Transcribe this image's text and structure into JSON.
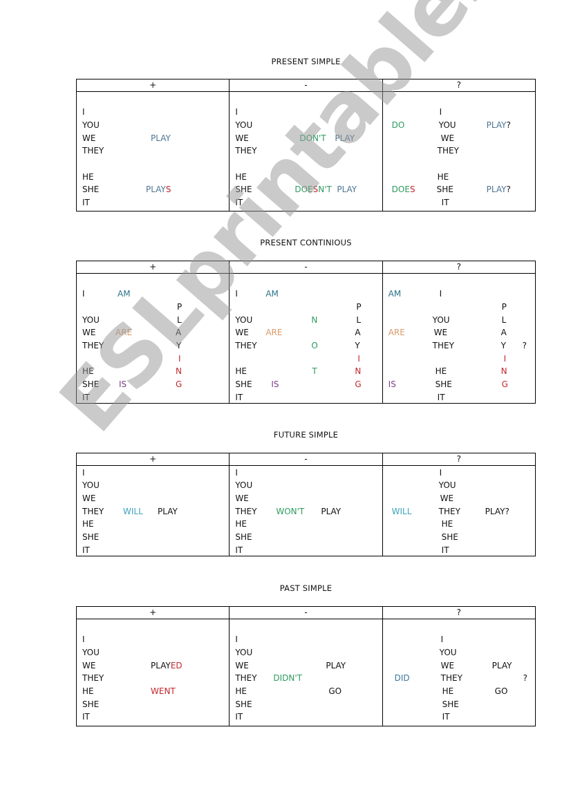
{
  "watermark": "ESLprintables.com",
  "headers": {
    "plus": "+",
    "minus": "-",
    "question": "?"
  },
  "sections": [
    {
      "title": "PRESENT SIMPLE",
      "plus": {
        "pronouns": [
          "I",
          "YOU",
          "WE",
          "THEY",
          "HE",
          "SHE",
          "IT"
        ],
        "verb_plural": "PLAY",
        "verb_singular_stem": "PLAY",
        "verb_singular_ending": "S"
      },
      "minus": {
        "pronouns": [
          "I",
          "YOU",
          "WE",
          "THEY",
          "HE",
          "SHE",
          "IT"
        ],
        "aux_plural": "DON'T",
        "verb_plural": "PLAY",
        "aux_singular_a": "DOE",
        "aux_singular_s": "S",
        "aux_singular_b": "N'T",
        "verb_singular": "PLAY"
      },
      "question": {
        "pronouns": [
          "I",
          "YOU",
          "WE",
          "THEY",
          "HE",
          "SHE",
          "IT"
        ],
        "aux_plural": "DO",
        "verb_plural": "PLAY",
        "qmark": "?",
        "aux_singular_stem": "DOE",
        "aux_singular_ending": "S",
        "verb_singular": "PLAY"
      }
    },
    {
      "title": "PRESENT CONTINIOUS",
      "plus": {
        "pronouns": [
          "I",
          "YOU",
          "WE",
          "THEY",
          "HE",
          "SHE",
          "IT"
        ],
        "aux_i": "AM",
        "aux_plural": "ARE",
        "aux_singular": "IS",
        "verb_letters": [
          "P",
          "L",
          "A",
          "Y",
          "I",
          "N",
          "G"
        ]
      },
      "minus": {
        "pronouns": [
          "I",
          "YOU",
          "WE",
          "THEY",
          "HE",
          "SHE",
          "IT"
        ],
        "aux_i": "AM",
        "aux_plural": "ARE",
        "aux_singular": "IS",
        "not_letters": [
          "N",
          "O",
          "T"
        ],
        "verb_letters": [
          "P",
          "L",
          "A",
          "Y",
          "I",
          "N",
          "G"
        ]
      },
      "question": {
        "pronouns": [
          "I",
          "YOU",
          "WE",
          "THEY",
          "HE",
          "SHE",
          "IT"
        ],
        "aux_i": "AM",
        "aux_plural": "ARE",
        "aux_singular": "IS",
        "verb_letters": [
          "P",
          "L",
          "A",
          "Y",
          "I",
          "N",
          "G"
        ],
        "qmark": "?"
      }
    },
    {
      "title": "FUTURE SIMPLE",
      "plus": {
        "pronouns": [
          "I",
          "YOU",
          "WE",
          "THEY",
          "HE",
          "SHE",
          "IT"
        ],
        "aux": "WILL",
        "verb": "PLAY"
      },
      "minus": {
        "pronouns": [
          "I",
          "YOU",
          "WE",
          "THEY",
          "HE",
          "SHE",
          "IT"
        ],
        "aux": "WON'T",
        "verb": "PLAY"
      },
      "question": {
        "pronouns": [
          "I",
          "YOU",
          "WE",
          "THEY",
          "HE",
          "SHE",
          "IT"
        ],
        "aux": "WILL",
        "verb": "PLAY?"
      }
    },
    {
      "title": "PAST SIMPLE",
      "plus": {
        "pronouns": [
          "I",
          "YOU",
          "WE",
          "THEY",
          "HE",
          "SHE",
          "IT"
        ],
        "regular_stem": "PLAY",
        "regular_ending": "ED",
        "irregular": "WENT"
      },
      "minus": {
        "pronouns": [
          "I",
          "YOU",
          "WE",
          "THEY",
          "HE",
          "SHE",
          "IT"
        ],
        "aux": "DIDN'T",
        "verb_regular": "PLAY",
        "verb_irregular": "GO"
      },
      "question": {
        "pronouns": [
          "I",
          "YOU",
          "WE",
          "THEY",
          "HE",
          "SHE",
          "IT"
        ],
        "aux": "DID",
        "verb_regular": "PLAY",
        "verb_irregular": "GO",
        "qmark": "?"
      }
    }
  ]
}
